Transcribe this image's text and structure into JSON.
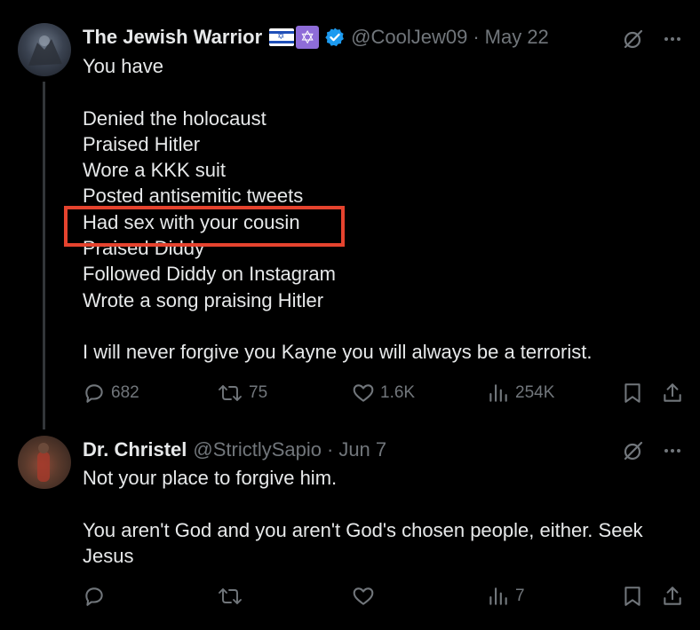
{
  "tweets": [
    {
      "author_name": "The Jewish Warrior",
      "handle": "@CoolJew09",
      "separator": "·",
      "date": "May 22",
      "lines": [
        "You have",
        "",
        "Denied the holocaust",
        "Praised Hitler",
        "Wore a KKK suit",
        "Posted antisemitic tweets",
        "Had sex with your cousin",
        "Praised Diddy",
        "Followed Diddy on Instagram",
        "Wrote a song praising Hitler",
        "",
        "I will never forgive you Kayne you will always be a terrorist."
      ],
      "replies": "682",
      "reposts": "75",
      "likes": "1.6K",
      "views": "254K"
    },
    {
      "author_name": "Dr. Christel",
      "handle": "@StrictlySapio",
      "separator": "·",
      "date": "Jun 7",
      "lines": [
        "Not your place to forgive him.",
        "",
        "You aren't God and you aren't God's chosen people, either.  Seek",
        "Jesus"
      ],
      "replies": "",
      "reposts": "",
      "likes": "",
      "views": "7"
    }
  ],
  "colors": {
    "background": "#000000",
    "text": "#e7e9ea",
    "muted": "#71767b",
    "verified": "#1d9bf0",
    "highlight_border": "#e5432e"
  },
  "icons": [
    "more-icon",
    "grok-icon",
    "reply-icon",
    "repost-icon",
    "like-icon",
    "views-icon",
    "bookmark-icon",
    "share-icon",
    "verified-badge-icon",
    "israel-flag-icon",
    "star-of-david-icon"
  ]
}
